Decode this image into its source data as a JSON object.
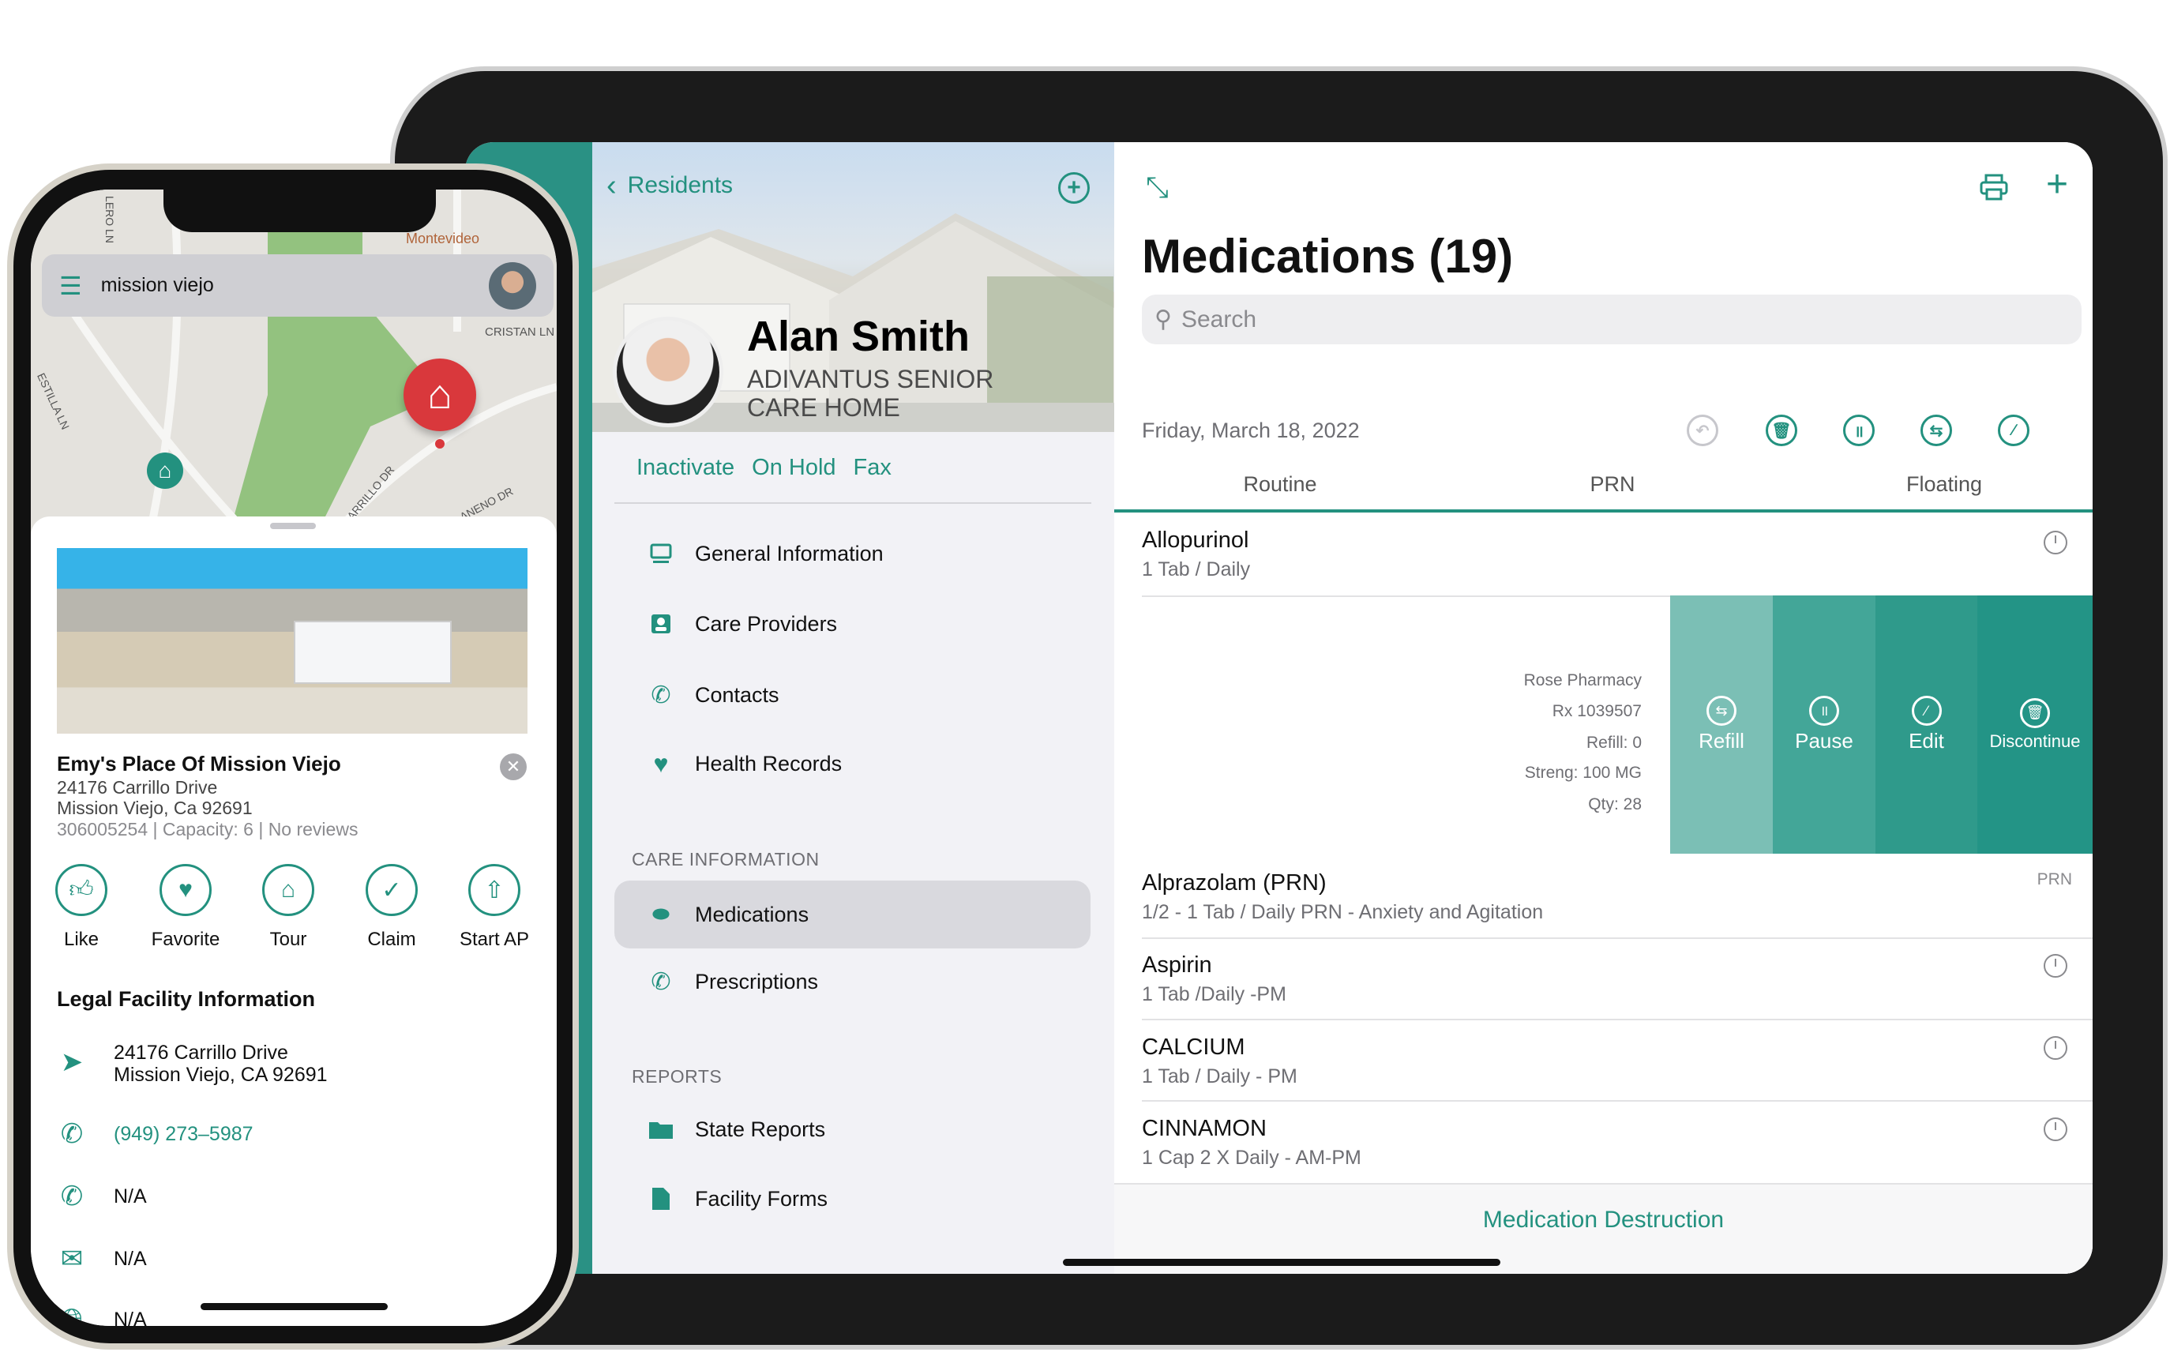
{
  "colors": {
    "accent": "#23917f",
    "refill": "#7bbfb5",
    "pause": "#43a698",
    "edit": "#2f9a8b",
    "discontinue": "#239486",
    "map_pin": "#d9383c"
  },
  "ipad": {
    "sidebar": {
      "back_label": "Residents",
      "resident_name": "Alan Smith",
      "facility_line1": "ADIVANTUS SENIOR",
      "facility_line2": "CARE HOME",
      "actions": [
        "Inactivate",
        "On Hold",
        "Fax"
      ],
      "items": [
        {
          "label": "General Information",
          "icon": "monitor-icon"
        },
        {
          "label": "Care Providers",
          "icon": "person-badge-icon"
        },
        {
          "label": "Contacts",
          "icon": "phone-icon"
        },
        {
          "label": "Health Records",
          "icon": "heart-icon"
        }
      ],
      "care_section": "CARE INFORMATION",
      "care_items": [
        {
          "label": "Medications",
          "icon": "pills-icon",
          "selected": true
        },
        {
          "label": "Prescriptions",
          "icon": "phone-icon"
        }
      ],
      "reports_section": "REPORTS",
      "report_items": [
        {
          "label": "State Reports",
          "icon": "folder-icon"
        },
        {
          "label": "Facility Forms",
          "icon": "document-icon"
        }
      ]
    },
    "main": {
      "title": "Medications (19)",
      "search_placeholder": "Search",
      "date": "Friday, March 18, 2022",
      "tabs": [
        "Routine",
        "PRN",
        "Floating"
      ],
      "active_tab": "Routine",
      "medications": [
        {
          "name": "Allopurinol",
          "detail": "1 Tab / Daily",
          "badge": "clock"
        },
        {
          "name": "Alprazolam (PRN)",
          "detail": "1/2 - 1 Tab / Daily PRN - Anxiety and Agitation",
          "badge": "PRN"
        },
        {
          "name": "Aspirin",
          "detail": "1 Tab /Daily -PM",
          "badge": "clock"
        },
        {
          "name": "CALCIUM",
          "detail": "1 Tab /  Daily - PM",
          "badge": "clock"
        },
        {
          "name": "CINNAMON",
          "detail": "1 Cap 2 X Daily - AM-PM",
          "badge": "clock"
        }
      ],
      "swipe_details": [
        "Rose Pharmacy",
        "Rx 1039507",
        "Refill: 0",
        "Streng: 100 MG",
        "Qty: 28"
      ],
      "swipe_actions": [
        "Refill",
        "Pause",
        "Edit",
        "Discontinue"
      ],
      "footer_button": "Medication Destruction"
    }
  },
  "phone": {
    "search_value": "mission viejo",
    "map_labels": [
      "Montevideo Elementary",
      "CRISTAN LN",
      "CARRILLO DR",
      "ANENO DR",
      "ESTILLA LN",
      "LERO LN"
    ],
    "listing": {
      "name": "Emy's Place Of Mission Viejo",
      "address1": "24176 Carrillo Drive",
      "address2": "Mission Viejo, Ca 92691",
      "meta": "306005254 | Capacity: 6 | No reviews"
    },
    "actions": [
      "Like",
      "Favorite",
      "Tour",
      "Claim",
      "Start AP"
    ],
    "legal_title": "Legal Facility Information",
    "legal_address1": "24176 Carrillo Drive",
    "legal_address2": "Mission Viejo, CA 92691",
    "phone": "(949) 273–5987",
    "fax": "N/A",
    "email": "N/A",
    "website": "N/A"
  }
}
